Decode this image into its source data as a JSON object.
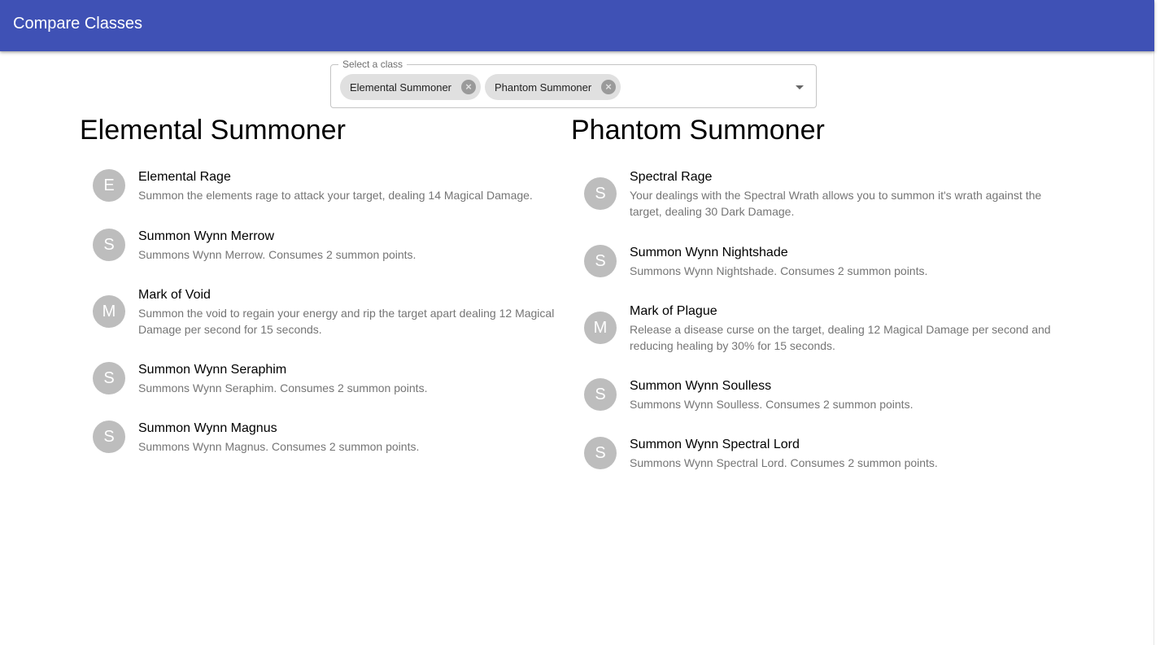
{
  "appbar": {
    "title": "Compare Classes"
  },
  "class_select": {
    "label": "Select a class",
    "chips": [
      {
        "label": "Elemental Summoner"
      },
      {
        "label": "Phantom Summoner"
      }
    ]
  },
  "columns": [
    {
      "title": "Elemental Summoner",
      "skills": [
        {
          "avatar": "E",
          "name": "Elemental Rage",
          "desc": "Summon the elements rage to attack your target, dealing 14 Magical Damage."
        },
        {
          "avatar": "S",
          "name": "Summon Wynn Merrow",
          "desc": "Summons Wynn Merrow. Consumes 2 summon points."
        },
        {
          "avatar": "M",
          "name": "Mark of Void",
          "desc": "Summon the void to regain your energy and rip the target apart dealing 12 Magical Damage per second for 15 seconds."
        },
        {
          "avatar": "S",
          "name": "Summon Wynn Seraphim",
          "desc": "Summons Wynn Seraphim. Consumes 2 summon points."
        },
        {
          "avatar": "S",
          "name": "Summon Wynn Magnus",
          "desc": "Summons Wynn Magnus. Consumes 2 summon points."
        }
      ]
    },
    {
      "title": "Phantom Summoner",
      "skills": [
        {
          "avatar": "S",
          "name": "Spectral Rage",
          "desc": "Your dealings with the Spectral Wrath allows you to summon it's wrath against the target, dealing 30 Dark Damage."
        },
        {
          "avatar": "S",
          "name": "Summon Wynn Nightshade",
          "desc": "Summons Wynn Nightshade. Consumes 2 summon points."
        },
        {
          "avatar": "M",
          "name": "Mark of Plague",
          "desc": "Release a disease curse on the target, dealing 12 Magical Damage per second and reducing healing by 30% for 15 seconds."
        },
        {
          "avatar": "S",
          "name": "Summon Wynn Soulless",
          "desc": "Summons Wynn Soulless. Consumes 2 summon points."
        },
        {
          "avatar": "S",
          "name": "Summon Wynn Spectral Lord",
          "desc": "Summons Wynn Spectral Lord. Consumes 2 summon points."
        }
      ]
    }
  ]
}
